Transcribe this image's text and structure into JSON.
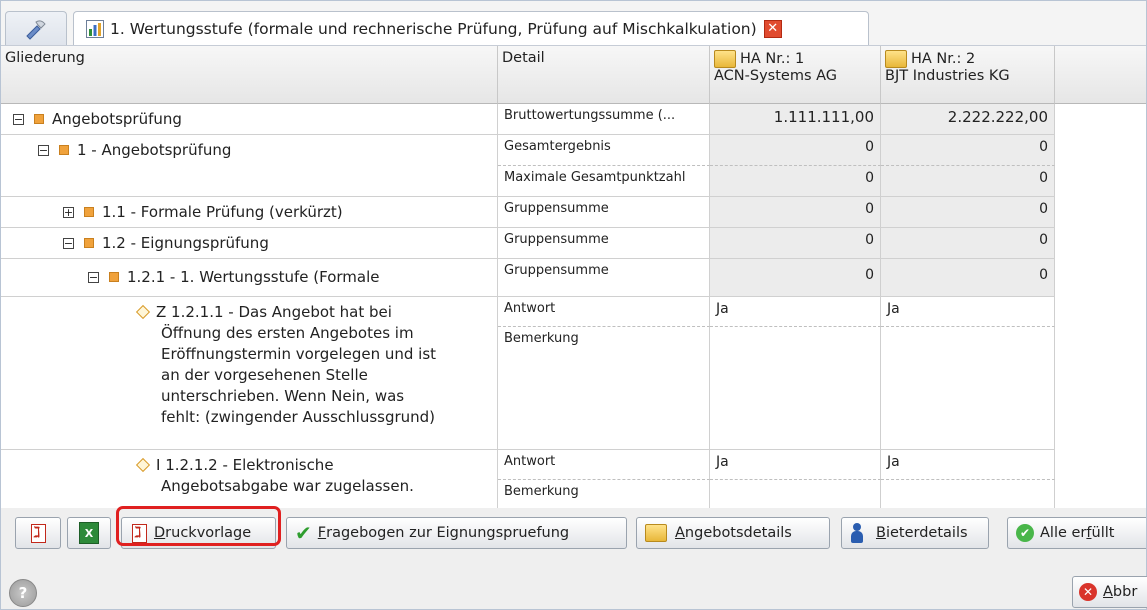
{
  "tabs": {
    "active_title": "1. Wertungsstufe (formale und rechnerische Prüfung, Prüfung auf Mischkalkulation)"
  },
  "header": {
    "gliederung": "Gliederung",
    "detail": "Detail",
    "bidders": [
      {
        "line1": "HA Nr.: 1",
        "line2": "ACN-Systems AG"
      },
      {
        "line1": "HA Nr.: 2",
        "line2": "BJT Industries KG"
      }
    ]
  },
  "tree": [
    {
      "toggle": "⊟",
      "label": "Angebotsprüfung"
    },
    {
      "toggle": "⊟",
      "label": "1 - Angebotsprüfung"
    },
    {
      "toggle": "⊞",
      "label": "1.1 - Formale Prüfung (verkürzt)"
    },
    {
      "toggle": "⊟",
      "label": "1.2 - Eignungsprüfung"
    },
    {
      "toggle": "⊟",
      "label": "1.2.1 - 1. Wertungsstufe (Formale"
    }
  ],
  "questions": [
    {
      "lines": [
        "Z 1.2.1.1 - Das Angebot hat bei",
        "Öffnung des ersten Angebotes im",
        "Eröffnungstermin vorgelegen und ist",
        "an der vorgesehenen Stelle",
        "unterschrieben. Wenn Nein, was",
        "fehlt: (zwingender Ausschlussgrund)"
      ]
    },
    {
      "lines": [
        "I 1.2.1.2 - Elektronische",
        "Angebotsabgabe war zugelassen."
      ]
    }
  ],
  "rows": [
    {
      "detail": "Bruttowertungssumme (...",
      "v1": "1.111.111,00",
      "v2": "2.222.222,00"
    },
    {
      "detail": "Gesamtergebnis",
      "v1": "0",
      "v2": "0"
    },
    {
      "detail": "Maximale Gesamtpunktzahl",
      "v1": "0",
      "v2": "0"
    },
    {
      "detail": "Gruppensumme",
      "v1": "0",
      "v2": "0"
    },
    {
      "detail": "Gruppensumme",
      "v1": "0",
      "v2": "0"
    },
    {
      "detail": "Gruppensumme",
      "v1": "0",
      "v2": "0"
    },
    {
      "detail": "Antwort",
      "v1": "Ja",
      "v2": "Ja"
    },
    {
      "detail": "Bemerkung",
      "v1": "",
      "v2": ""
    },
    {
      "detail": "Antwort",
      "v1": "Ja",
      "v2": "Ja"
    },
    {
      "detail": "Bemerkung",
      "v1": "",
      "v2": ""
    }
  ],
  "toolbar": {
    "druckvorlage_hot": "D",
    "druckvorlage_rest": "ruckvorlage",
    "fragebogen_hot": "F",
    "fragebogen_rest": "ragebogen zur Eignungspruefung",
    "angebot_hot": "A",
    "angebot_rest": "ngebotsdetails",
    "bieter_hot": "B",
    "bieter_rest": "ieterdetails",
    "alle_pre": "Alle er",
    "alle_hot": "f",
    "alle_post": "üllt"
  },
  "footer": {
    "help": "?",
    "abbr_hot": "A",
    "abbr_rest": "bbr"
  }
}
